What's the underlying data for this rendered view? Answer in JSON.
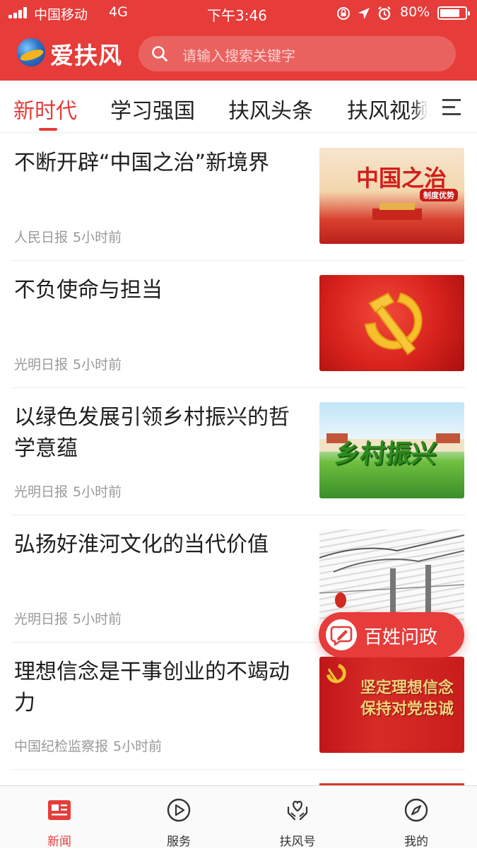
{
  "status_bar": {
    "carrier": "中国移动",
    "network": "4G",
    "time": "下午3:46",
    "battery": "80%",
    "battery_level": 0.8
  },
  "header": {
    "app_name": "爱扶风",
    "search_placeholder": "请输入搜索关键字",
    "brand_color": "#e63c3a"
  },
  "tabs": [
    {
      "label": "新时代",
      "active": true
    },
    {
      "label": "学习强国",
      "active": false
    },
    {
      "label": "扶风头条",
      "active": false
    },
    {
      "label": "扶风视频",
      "active": false
    }
  ],
  "menu_icon": "menu-icon",
  "feed": [
    {
      "title": "不断开辟“中国之治”新境界",
      "source": "人民日报",
      "time": "5小时前",
      "thumb_text": "中国之治",
      "thumb_sub": "制度优势"
    },
    {
      "title": "不负使命与担当",
      "source": "光明日报",
      "time": "5小时前",
      "thumb_icon": "hammer-sickle-icon"
    },
    {
      "title": "以绿色发展引领乡村振兴的哲学意蕴",
      "source": "光明日报",
      "time": "5小时前",
      "thumb_text": "乡村振兴"
    },
    {
      "title": "弘扬好淮河文化的当代价值",
      "source": "光明日报",
      "time": "5小时前",
      "thumb_icon": "pavilion-sketch"
    },
    {
      "title": "理想信念是干事创业的不竭动力",
      "source": "中国纪检监察报",
      "time": "5小时前",
      "thumb_text_1": "坚定理想信念",
      "thumb_text_2": "保持对党忠诚"
    }
  ],
  "floating_button": {
    "label": "百姓问政",
    "icon": "edit-chat-icon"
  },
  "tab_bar": [
    {
      "label": "新闻",
      "icon": "news-icon",
      "active": true
    },
    {
      "label": "服务",
      "icon": "play-circle-icon",
      "active": false
    },
    {
      "label": "扶风号",
      "icon": "heart-hands-icon",
      "active": false
    },
    {
      "label": "我的",
      "icon": "compass-icon",
      "active": false
    }
  ]
}
